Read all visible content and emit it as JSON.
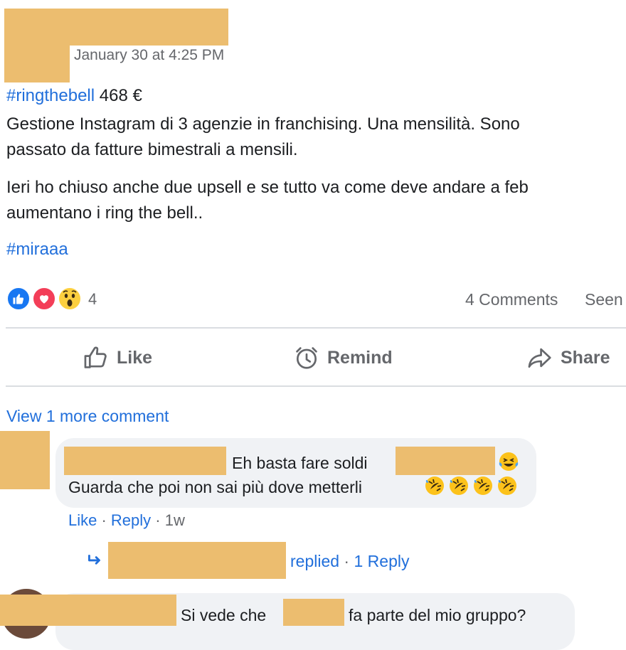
{
  "post": {
    "timestamp": "January 30 at 4:25 PM",
    "hashtag1": "#ringthebell",
    "amount": " 468 €",
    "line1": "Gestione Instagram di 3 agenzie in franchising. Una mensilità. Sono",
    "line2": "passato da fatture bimestrali a mensili.",
    "line3": "Ieri ho chiuso anche due upsell e se tutto va come deve andare a feb",
    "line4": "aumentano i ring the bell..",
    "hashtag2": "#miraaa"
  },
  "reactions": {
    "count": "4",
    "comments": "4 Comments",
    "seen": "Seen",
    "icons": [
      "like-icon",
      "love-icon",
      "wow-icon"
    ]
  },
  "actions": {
    "like": "Like",
    "remind": "Remind",
    "share": "Share"
  },
  "comments": {
    "view_more": "View 1 more comment",
    "first": {
      "text_part1": "Eh basta fare soldi",
      "line2": "Guarda che poi non sai più dove metterli",
      "like": "Like",
      "sep1": " · ",
      "reply": "Reply",
      "sep2": " · ",
      "age": "1w"
    },
    "replies": {
      "replied": "replied",
      "sep": " · ",
      "count": "1 Reply"
    },
    "second": {
      "text_part1": "Si vede che",
      "text_part2": "fa parte del mio gruppo?"
    }
  },
  "colors": {
    "link": "#216fdb",
    "redaction": "#ecbd6f",
    "bubble": "#f0f2f5"
  }
}
